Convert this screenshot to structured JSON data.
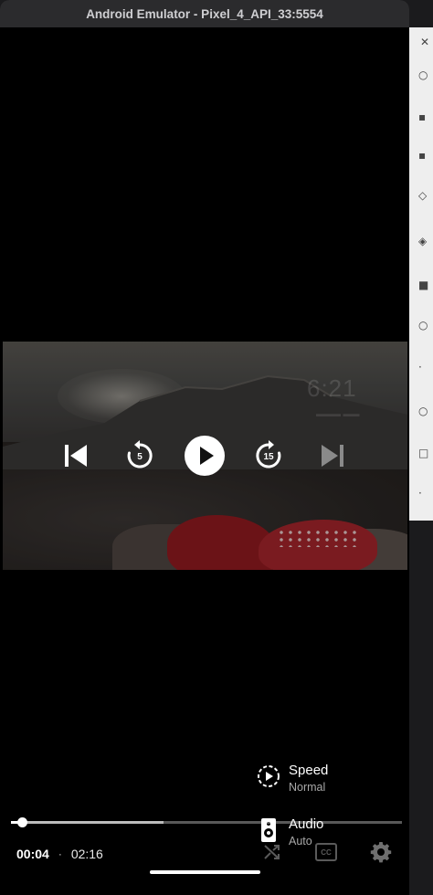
{
  "window": {
    "title": "Android Emulator - Pixel_4_API_33:5554"
  },
  "video": {
    "overlay_time": "6:21"
  },
  "controls": {
    "prev_icon": "skip-previous-icon",
    "rewind_icon": "replay-5-icon",
    "rewind_seconds": "5",
    "play_icon": "play-icon",
    "forward_icon": "forward-15-icon",
    "forward_seconds": "15",
    "next_icon": "skip-next-icon"
  },
  "progress": {
    "position_fraction": 0.029,
    "buffered_fraction": 0.39
  },
  "time": {
    "current": "00:04",
    "separator": "·",
    "duration": "02:16"
  },
  "bottom_bar": {
    "shuffle_icon": "shuffle-icon",
    "cc_label": "CC",
    "settings_icon": "gear-icon"
  },
  "settings_menu": {
    "items": [
      {
        "label": "Speed",
        "value": "Normal",
        "icon": "speed-icon"
      },
      {
        "label": "Audio",
        "value": "Auto",
        "icon": "speaker-icon"
      }
    ]
  },
  "colors": {
    "background": "#000000",
    "accent": "#ffffff",
    "title_bar": "#2b2b2d"
  }
}
